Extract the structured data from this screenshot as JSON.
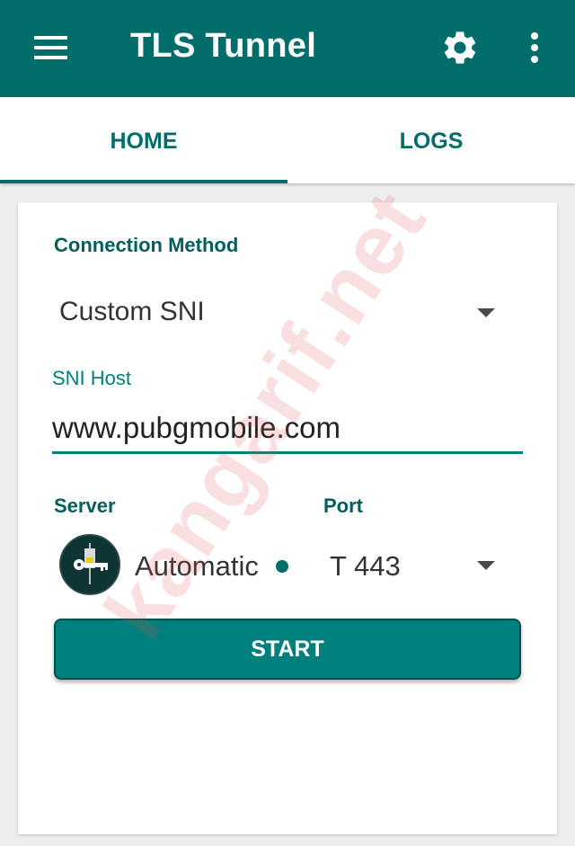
{
  "appbar": {
    "title": "TLS Tunnel",
    "menu_icon": "hamburger-menu-icon",
    "settings_icon": "gear-icon",
    "more_icon": "more-vertical-icon",
    "background": "#006d6b"
  },
  "tabs": [
    {
      "label": "HOME",
      "active": true
    },
    {
      "label": "LOGS",
      "active": false
    }
  ],
  "form": {
    "connection_method_label": "Connection Method",
    "connection_method_value": "Custom SNI",
    "sni_host_label": "SNI Host",
    "sni_host_value": "www.pubgmobile.com",
    "server_label": "Server",
    "server_value": "Automatic",
    "port_label": "Port",
    "port_value": "T 443",
    "start_label": "START"
  },
  "watermark": "kangarif.net",
  "colors": {
    "accent": "#006d6b",
    "accent_light": "#00807d",
    "button_border": "#004f4d"
  }
}
